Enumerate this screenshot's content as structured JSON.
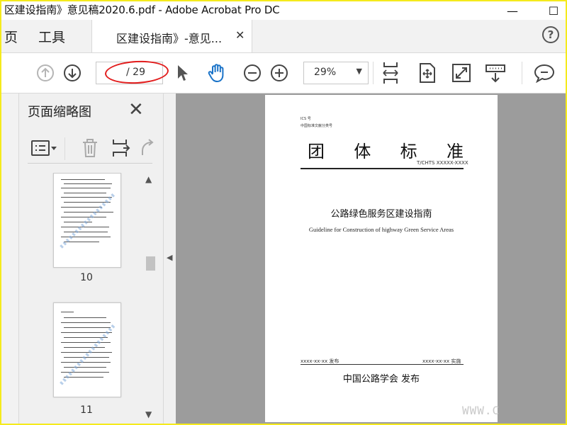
{
  "window": {
    "title": "区建设指南》意见稿2020.6.pdf - Adobe Acrobat Pro DC",
    "minimize_glyph": "—",
    "maximize_glyph": "☐",
    "close_glyph": "✕"
  },
  "menu": {
    "home_label": "页",
    "tools_label": "工具"
  },
  "tab": {
    "label": "区建设指南》-意见...",
    "close_glyph": "✕"
  },
  "help": {
    "glyph": "?"
  },
  "toolbar": {
    "page_current": "",
    "page_total": "/ 29",
    "zoom": "29%",
    "zoom_caret": "▼"
  },
  "annotation": {
    "color": "#e21d1d"
  },
  "panel": {
    "title": "页面缩略图",
    "close_glyph": "✕",
    "thumbnails": [
      {
        "label": "10"
      },
      {
        "label": "11"
      }
    ]
  },
  "document": {
    "ics": "ICS 号",
    "classification": "中国标准文献分类号",
    "std_chars": [
      "团",
      "体",
      "标",
      "准"
    ],
    "std_code": "T/CHTS XXXXX-XXXX",
    "title": "公路绿色服务区建设指南",
    "subtitle": "Guideline for Construction of highway Green Service Areas",
    "publish_date": "xxxx-xx-xx 发布",
    "implement_date": "xxxx-xx-xx 实施",
    "publisher": "中国公路学会 发布"
  },
  "watermark": "WWW.C",
  "colors": {
    "frame": "#f5ea1c",
    "hand_tool": "#1a73c8",
    "doc_background": "#9c9c9c",
    "thumb_watermark": "#7fa9d9"
  }
}
